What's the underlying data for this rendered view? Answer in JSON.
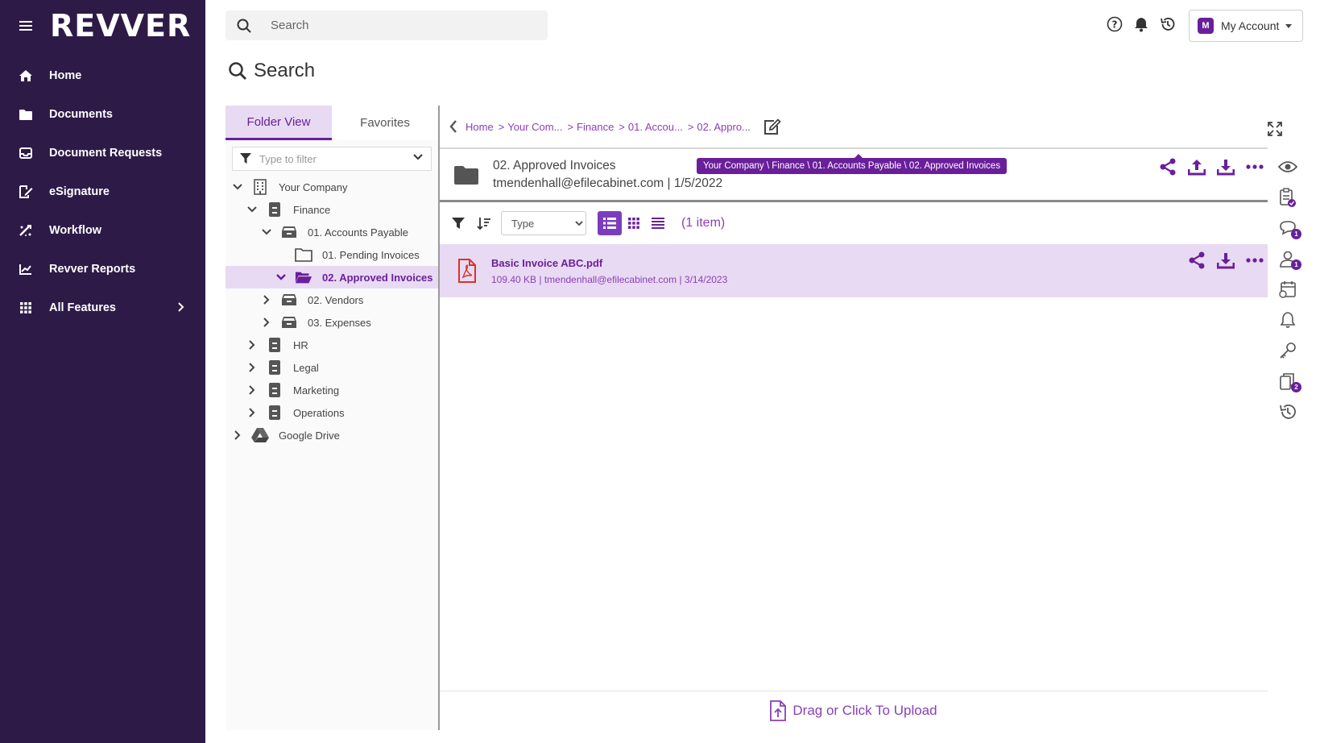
{
  "brand": {
    "logo_text": "REVVER"
  },
  "sidebar": {
    "items": [
      {
        "label": "Home",
        "icon": "home-icon"
      },
      {
        "label": "Documents",
        "icon": "folder-icon"
      },
      {
        "label": "Document Requests",
        "icon": "inbox-icon"
      },
      {
        "label": "eSignature",
        "icon": "signature-icon"
      },
      {
        "label": "Workflow",
        "icon": "workflow-icon"
      },
      {
        "label": "Revver Reports",
        "icon": "chart-icon"
      },
      {
        "label": "All Features",
        "icon": "grid-icon"
      }
    ]
  },
  "topbar": {
    "search_placeholder": "Search",
    "account": {
      "initial": "M",
      "label": "My Account"
    }
  },
  "page": {
    "title": "Search"
  },
  "tree_panel": {
    "tabs": [
      "Folder View",
      "Favorites"
    ],
    "filter_placeholder": "Type to filter",
    "nodes": [
      {
        "label": "Your Company",
        "expanded": true,
        "icon": "building-icon"
      },
      {
        "label": "Finance",
        "expanded": true,
        "icon": "cabinet-icon"
      },
      {
        "label": "01. Accounts Payable",
        "expanded": true,
        "icon": "drawer-icon"
      },
      {
        "label": "01. Pending Invoices",
        "expanded": false,
        "icon": "folder-outline-icon"
      },
      {
        "label": "02. Approved Invoices",
        "expanded": true,
        "icon": "folder-open-icon",
        "selected": true
      },
      {
        "label": "02. Vendors",
        "expanded": false,
        "icon": "drawer-icon"
      },
      {
        "label": "03. Expenses",
        "expanded": false,
        "icon": "drawer-icon"
      },
      {
        "label": "HR",
        "expanded": false,
        "icon": "cabinet-icon"
      },
      {
        "label": "Legal",
        "expanded": false,
        "icon": "cabinet-icon"
      },
      {
        "label": "Marketing",
        "expanded": false,
        "icon": "cabinet-icon"
      },
      {
        "label": "Operations",
        "expanded": false,
        "icon": "cabinet-icon"
      },
      {
        "label": "Google Drive",
        "expanded": false,
        "icon": "google-drive-icon"
      }
    ]
  },
  "breadcrumb": {
    "items": [
      "Home",
      "Your Com...",
      "Finance",
      "01. Accou...",
      "02. Appro..."
    ],
    "separator": ">"
  },
  "folder": {
    "name": "02. Approved Invoices",
    "meta": "tmendenhall@efilecabinet.com | 1/5/2022",
    "path_tooltip": "Your Company \\ Finance \\ 01. Accounts Payable \\ 02. Approved Invoices"
  },
  "toolbar": {
    "sort_options": [
      "Type"
    ],
    "item_count": "(1 item)"
  },
  "files": [
    {
      "name": "Basic Invoice ABC.pdf",
      "meta": "109.40 KB | tmendenhall@efilecabinet.com | 3/14/2023"
    }
  ],
  "upload": {
    "label": "Drag or Click To Upload"
  },
  "right_rail": {
    "items": [
      {
        "icon": "preview-eye-icon",
        "badge": ""
      },
      {
        "icon": "checklist-icon",
        "badge": ""
      },
      {
        "icon": "comments-icon",
        "badge": "1"
      },
      {
        "icon": "user-permissions-icon",
        "badge": "1"
      },
      {
        "icon": "calendar-retention-icon",
        "badge": ""
      },
      {
        "icon": "alerts-bell-icon",
        "badge": ""
      },
      {
        "icon": "key-icon",
        "badge": ""
      },
      {
        "icon": "copies-icon",
        "badge": "2"
      },
      {
        "icon": "history-icon",
        "badge": ""
      }
    ]
  },
  "colors": {
    "sidebar_bg": "#2e1a47",
    "accent": "#6a1f9a",
    "accent_light": "#e8daf3",
    "pdf_red": "#d9342b"
  }
}
